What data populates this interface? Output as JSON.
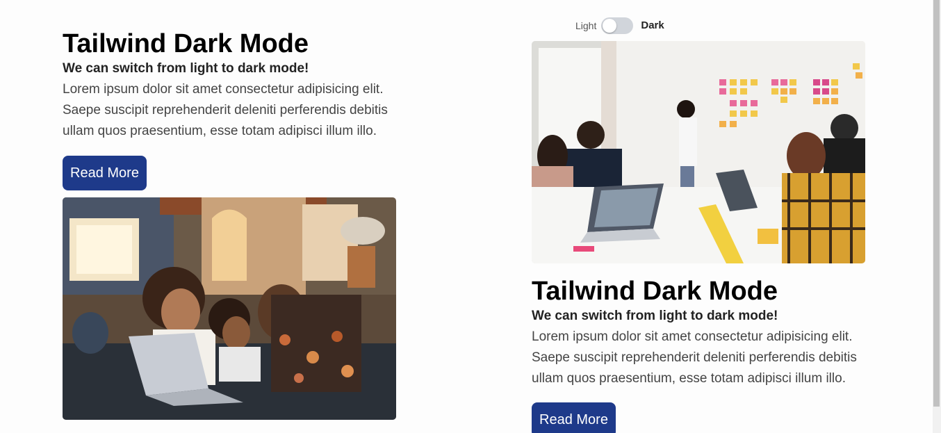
{
  "theme_toggle": {
    "light_label": "Light",
    "dark_label": "Dark",
    "state": "light"
  },
  "cards": [
    {
      "title": "Tailwind Dark Mode",
      "subtitle": "We can switch from light to dark mode!",
      "body": "Lorem ipsum dolor sit amet consectetur adipisicing elit. Saepe suscipit reprehenderit deleniti perferendis debitis ullam quos praesentium, esse totam adipisci illum illo.",
      "button_label": "Read More"
    },
    {
      "title": "Tailwind Dark Mode",
      "subtitle": "We can switch from light to dark mode!",
      "body": "Lorem ipsum dolor sit amet consectetur adipisicing elit. Saepe suscipit reprehenderit deleniti perferendis debitis ullam quos praesentium, esse totam adipisci illum illo.",
      "button_label": "Read More"
    }
  ],
  "colors": {
    "button_bg": "#1e3a8a",
    "button_text": "#ffffff",
    "toggle_track": "#d1d5db",
    "title": "#000000",
    "body_text": "#444444"
  }
}
